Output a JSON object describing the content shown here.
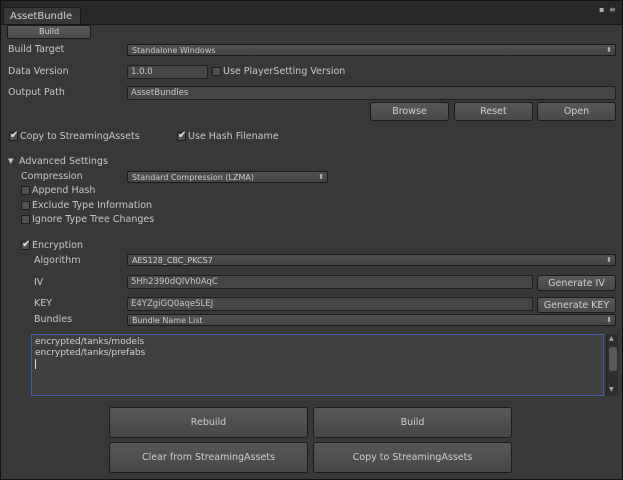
{
  "window": {
    "tab_title": "AssetBundle",
    "toolbar_button": "Build",
    "lock_glyph": "▪",
    "menu_glyph": "≡"
  },
  "build_target": {
    "label": "Build Target",
    "value": "Standalone Windows"
  },
  "data_version": {
    "label": "Data Version",
    "value": "1.0.0",
    "use_player_setting_label": "Use PlayerSetting Version",
    "use_player_setting_checked": false
  },
  "output_path": {
    "label": "Output Path",
    "value": "AssetBundles"
  },
  "output_buttons": {
    "browse": "Browse",
    "reset": "Reset",
    "open": "Open"
  },
  "copy_to_streaming": {
    "label": "Copy to StreamingAssets",
    "checked": true
  },
  "use_hash_filename": {
    "label": "Use Hash Filename",
    "checked": true
  },
  "advanced": {
    "label": "Advanced Settings",
    "compression_label": "Compression",
    "compression_value": "Standard Compression (LZMA)",
    "append_hash": "Append Hash",
    "exclude_type_info": "Exclude Type Information",
    "ignore_type_tree": "Ignore Type Tree Changes"
  },
  "encryption": {
    "label": "Encryption",
    "checked": true,
    "algorithm_label": "Algorithm",
    "algorithm_value": "AES128_CBC_PKCS7",
    "iv_label": "IV",
    "iv_value": "5Hh2390dQlVh0AqC",
    "generate_iv": "Generate IV",
    "key_label": "KEY",
    "key_value": "E4YZgiGQ0aqeSLEJ",
    "generate_key": "Generate KEY",
    "bundles_label": "Bundles",
    "bundles_value": "Bundle Name List",
    "bundle_lines": [
      "encrypted/tanks/models",
      "encrypted/tanks/prefabs"
    ]
  },
  "actions": {
    "rebuild": "Rebuild",
    "build": "Build",
    "clear": "Clear from StreamingAssets",
    "copy": "Copy to StreamingAssets"
  }
}
